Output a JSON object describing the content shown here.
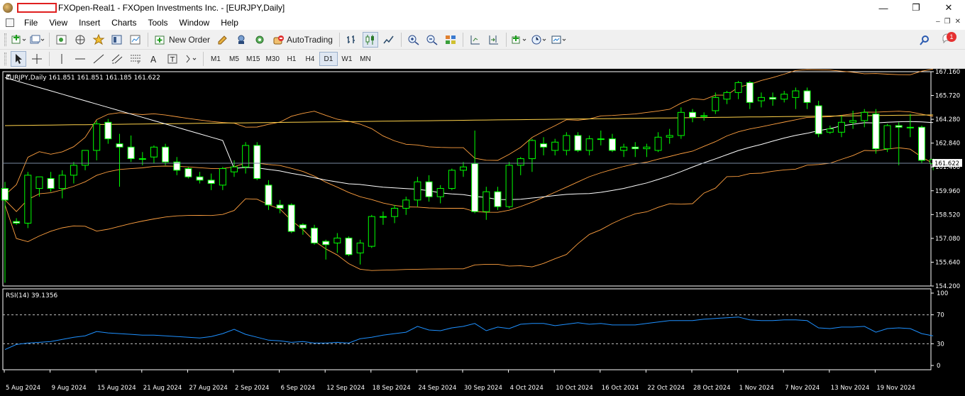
{
  "titlebar": {
    "title": "FXOpen-Real1 - FXOpen Investments Inc. - [EURJPY,Daily]",
    "minimize": "—",
    "maximize": "❐",
    "close": "✕"
  },
  "menu": {
    "items": [
      "File",
      "View",
      "Insert",
      "Charts",
      "Tools",
      "Window",
      "Help"
    ],
    "mdi_minimize": "–",
    "mdi_restore": "❐",
    "mdi_close": "✕"
  },
  "toolbar1": {
    "new_order": "New Order",
    "autotrading": "AutoTrading"
  },
  "toolbar2": {
    "timeframes": [
      "M1",
      "M5",
      "M15",
      "M30",
      "H1",
      "H4",
      "D1",
      "W1",
      "MN"
    ],
    "active_timeframe": "D1"
  },
  "notifications": {
    "count": "1"
  },
  "chart": {
    "header": "EURJPY,Daily  161.851 161.851 161.185 161.622",
    "bid_label": "161.622",
    "bid_label_under": "161.480",
    "price_axis": [
      "167.160",
      "165.720",
      "164.280",
      "162.840",
      "161.400",
      "159.960",
      "158.520",
      "157.080",
      "155.640",
      "154.200"
    ],
    "rsi_header": "RSI(14) 39.1356",
    "rsi_axis": [
      "100",
      "70",
      "30",
      "0"
    ],
    "date_axis": [
      "5 Aug 2024",
      "9 Aug 2024",
      "15 Aug 2024",
      "21 Aug 2024",
      "27 Aug 2024",
      "2 Sep 2024",
      "6 Sep 2024",
      "12 Sep 2024",
      "18 Sep 2024",
      "24 Sep 2024",
      "30 Sep 2024",
      "4 Oct 2024",
      "10 Oct 2024",
      "16 Oct 2024",
      "22 Oct 2024",
      "28 Oct 2024",
      "1 Nov 2024",
      "7 Nov 2024",
      "13 Nov 2024",
      "19 Nov 2024"
    ],
    "colors": {
      "background": "#000000",
      "bull_fill": "#000000",
      "bear_fill": "#ffffff",
      "candle_outline": "#00ff00",
      "ma_slow": "#ffffff",
      "bollinger": "#ffa040",
      "ma_long": "#ffd24a",
      "bid_line": "#7a8aa0",
      "rsi_line": "#1e90ff",
      "rsi_levels": "#c0c0c0",
      "axis_text": "#ffffff"
    }
  },
  "chart_data": {
    "type": "candlestick",
    "symbol": "EURJPY",
    "timeframe": "Daily",
    "ylim": [
      154.2,
      167.16
    ],
    "candles": [
      {
        "o": 160.1,
        "h": 160.5,
        "l": 154.4,
        "c": 159.4
      },
      {
        "o": 158.1,
        "h": 158.3,
        "l": 157.9,
        "c": 158.0
      },
      {
        "o": 158.0,
        "h": 161.1,
        "l": 157.7,
        "c": 160.9
      },
      {
        "o": 160.1,
        "h": 160.8,
        "l": 159.6,
        "c": 160.8
      },
      {
        "o": 160.7,
        "h": 161.1,
        "l": 159.9,
        "c": 160.1
      },
      {
        "o": 160.1,
        "h": 161.2,
        "l": 159.5,
        "c": 160.9
      },
      {
        "o": 160.9,
        "h": 161.7,
        "l": 160.4,
        "c": 161.5
      },
      {
        "o": 161.5,
        "h": 162.2,
        "l": 161.2,
        "c": 162.4
      },
      {
        "o": 162.4,
        "h": 164.2,
        "l": 161.8,
        "c": 164.0
      },
      {
        "o": 164.1,
        "h": 164.3,
        "l": 162.8,
        "c": 163.1
      },
      {
        "o": 162.8,
        "h": 163.4,
        "l": 160.2,
        "c": 162.6
      },
      {
        "o": 162.6,
        "h": 163.3,
        "l": 161.7,
        "c": 161.9
      },
      {
        "o": 161.9,
        "h": 162.3,
        "l": 161.5,
        "c": 161.9
      },
      {
        "o": 162.0,
        "h": 162.7,
        "l": 161.6,
        "c": 162.6
      },
      {
        "o": 162.6,
        "h": 162.8,
        "l": 161.5,
        "c": 161.7
      },
      {
        "o": 161.7,
        "h": 162.0,
        "l": 160.9,
        "c": 161.2
      },
      {
        "o": 161.3,
        "h": 161.4,
        "l": 160.7,
        "c": 160.8
      },
      {
        "o": 160.8,
        "h": 161.1,
        "l": 160.4,
        "c": 160.6
      },
      {
        "o": 160.6,
        "h": 161.0,
        "l": 160.0,
        "c": 160.4
      },
      {
        "o": 160.3,
        "h": 161.4,
        "l": 160.0,
        "c": 161.3
      },
      {
        "o": 161.1,
        "h": 161.8,
        "l": 160.8,
        "c": 161.4
      },
      {
        "o": 161.4,
        "h": 162.9,
        "l": 161.0,
        "c": 162.7
      },
      {
        "o": 162.7,
        "h": 162.9,
        "l": 160.6,
        "c": 160.7
      },
      {
        "o": 160.3,
        "h": 160.6,
        "l": 158.8,
        "c": 159.1
      },
      {
        "o": 159.1,
        "h": 159.4,
        "l": 158.6,
        "c": 158.9
      },
      {
        "o": 159.1,
        "h": 159.2,
        "l": 157.4,
        "c": 157.5
      },
      {
        "o": 157.9,
        "h": 158.0,
        "l": 157.3,
        "c": 157.7
      },
      {
        "o": 157.7,
        "h": 157.9,
        "l": 156.7,
        "c": 156.8
      },
      {
        "o": 156.9,
        "h": 157.0,
        "l": 155.8,
        "c": 156.7
      },
      {
        "o": 156.8,
        "h": 157.4,
        "l": 156.2,
        "c": 157.1
      },
      {
        "o": 157.1,
        "h": 157.2,
        "l": 156.0,
        "c": 156.1
      },
      {
        "o": 156.2,
        "h": 157.0,
        "l": 155.5,
        "c": 156.8
      },
      {
        "o": 156.6,
        "h": 158.5,
        "l": 156.5,
        "c": 158.4
      },
      {
        "o": 158.4,
        "h": 158.7,
        "l": 157.9,
        "c": 158.4
      },
      {
        "o": 158.4,
        "h": 159.1,
        "l": 158.0,
        "c": 158.9
      },
      {
        "o": 158.9,
        "h": 159.6,
        "l": 158.5,
        "c": 159.4
      },
      {
        "o": 159.4,
        "h": 160.8,
        "l": 159.0,
        "c": 160.5
      },
      {
        "o": 160.5,
        "h": 160.9,
        "l": 159.3,
        "c": 159.6
      },
      {
        "o": 159.6,
        "h": 160.3,
        "l": 159.2,
        "c": 160.1
      },
      {
        "o": 160.1,
        "h": 161.3,
        "l": 160.0,
        "c": 161.2
      },
      {
        "o": 161.2,
        "h": 161.7,
        "l": 160.8,
        "c": 161.4
      },
      {
        "o": 161.6,
        "h": 163.6,
        "l": 158.6,
        "c": 158.7
      },
      {
        "o": 158.7,
        "h": 160.2,
        "l": 158.2,
        "c": 159.9
      },
      {
        "o": 159.9,
        "h": 160.2,
        "l": 158.8,
        "c": 159.0
      },
      {
        "o": 159.0,
        "h": 161.7,
        "l": 158.9,
        "c": 161.5
      },
      {
        "o": 161.5,
        "h": 162.0,
        "l": 160.9,
        "c": 161.9
      },
      {
        "o": 161.9,
        "h": 163.1,
        "l": 161.1,
        "c": 163.0
      },
      {
        "o": 162.8,
        "h": 163.2,
        "l": 162.1,
        "c": 162.6
      },
      {
        "o": 162.4,
        "h": 163.1,
        "l": 162.1,
        "c": 162.9
      },
      {
        "o": 162.4,
        "h": 163.5,
        "l": 162.1,
        "c": 163.3
      },
      {
        "o": 163.3,
        "h": 163.5,
        "l": 162.3,
        "c": 162.4
      },
      {
        "o": 162.4,
        "h": 163.3,
        "l": 162.1,
        "c": 163.1
      },
      {
        "o": 163.1,
        "h": 163.6,
        "l": 162.7,
        "c": 163.1
      },
      {
        "o": 163.1,
        "h": 163.4,
        "l": 162.3,
        "c": 162.4
      },
      {
        "o": 162.4,
        "h": 162.8,
        "l": 162.0,
        "c": 162.6
      },
      {
        "o": 162.6,
        "h": 162.9,
        "l": 162.0,
        "c": 162.5
      },
      {
        "o": 162.5,
        "h": 162.8,
        "l": 162.0,
        "c": 162.6
      },
      {
        "o": 162.4,
        "h": 163.5,
        "l": 162.3,
        "c": 163.2
      },
      {
        "o": 163.2,
        "h": 163.7,
        "l": 162.8,
        "c": 163.3
      },
      {
        "o": 163.3,
        "h": 165.0,
        "l": 163.1,
        "c": 164.7
      },
      {
        "o": 164.7,
        "h": 164.9,
        "l": 164.1,
        "c": 164.4
      },
      {
        "o": 164.5,
        "h": 164.7,
        "l": 164.2,
        "c": 164.5
      },
      {
        "o": 164.8,
        "h": 165.9,
        "l": 164.6,
        "c": 165.6
      },
      {
        "o": 165.5,
        "h": 166.0,
        "l": 165.2,
        "c": 165.9
      },
      {
        "o": 165.9,
        "h": 166.6,
        "l": 165.5,
        "c": 166.5
      },
      {
        "o": 166.5,
        "h": 166.6,
        "l": 164.9,
        "c": 165.3
      },
      {
        "o": 165.4,
        "h": 165.9,
        "l": 165.0,
        "c": 165.6
      },
      {
        "o": 165.6,
        "h": 165.9,
        "l": 165.1,
        "c": 165.5
      },
      {
        "o": 165.5,
        "h": 166.0,
        "l": 165.3,
        "c": 165.8
      },
      {
        "o": 165.6,
        "h": 166.2,
        "l": 164.9,
        "c": 166.0
      },
      {
        "o": 166.0,
        "h": 166.2,
        "l": 164.9,
        "c": 165.3
      },
      {
        "o": 165.1,
        "h": 165.4,
        "l": 163.2,
        "c": 163.4
      },
      {
        "o": 163.5,
        "h": 163.9,
        "l": 163.4,
        "c": 163.7
      },
      {
        "o": 163.5,
        "h": 164.5,
        "l": 163.2,
        "c": 164.1
      },
      {
        "o": 164.1,
        "h": 164.8,
        "l": 163.7,
        "c": 164.2
      },
      {
        "o": 164.2,
        "h": 164.9,
        "l": 163.8,
        "c": 164.7
      },
      {
        "o": 164.6,
        "h": 164.9,
        "l": 162.2,
        "c": 162.5
      },
      {
        "o": 162.5,
        "h": 164.0,
        "l": 162.3,
        "c": 163.9
      },
      {
        "o": 163.9,
        "h": 164.1,
        "l": 161.5,
        "c": 163.8
      },
      {
        "o": 163.8,
        "h": 164.6,
        "l": 163.2,
        "c": 163.8
      },
      {
        "o": 163.8,
        "h": 163.9,
        "l": 161.6,
        "c": 161.8
      },
      {
        "o": 161.6,
        "h": 161.9,
        "l": 161.2,
        "c": 161.85
      }
    ],
    "rsi": {
      "period": 14,
      "value": 39.1356,
      "levels": [
        70,
        30
      ],
      "ylim": [
        0,
        100
      ],
      "values": [
        22,
        29,
        31,
        32,
        33,
        36,
        39,
        41,
        47,
        45,
        44,
        43,
        42,
        42,
        41,
        40,
        39,
        38,
        40,
        44,
        50,
        43,
        39,
        35,
        34,
        32,
        33,
        31,
        31,
        32,
        31,
        37,
        39,
        42,
        44,
        46,
        54,
        49,
        48,
        52,
        54,
        58,
        48,
        53,
        51,
        57,
        58,
        58,
        55,
        57,
        59,
        57,
        58,
        56,
        56,
        56,
        58,
        60,
        62,
        62,
        62,
        64,
        65,
        66,
        67,
        63,
        62,
        62,
        63,
        63,
        62,
        52,
        51,
        53,
        53,
        54,
        46,
        51,
        52,
        51,
        44,
        41
      ]
    }
  }
}
